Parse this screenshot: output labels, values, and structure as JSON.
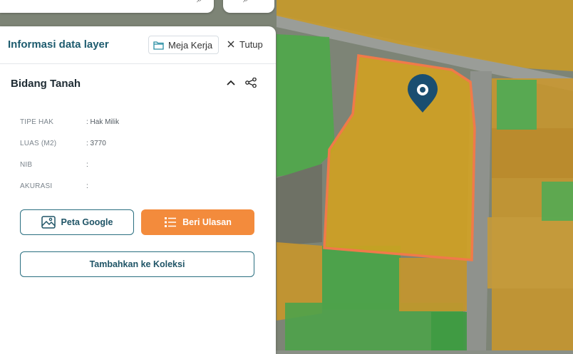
{
  "colors": {
    "accent": "#1d5b6e",
    "primary_button": "#f38b3c",
    "parcel_fill": "#d4a21f",
    "parcel_outline": "#f07a4a",
    "green_parcel": "#4caf50",
    "marker": "#1a4e70"
  },
  "panel": {
    "title": "Informasi data layer",
    "workspace_button": "Meja Kerja",
    "close_button": "Tutup",
    "section_title": "Bidang Tanah",
    "attributes": [
      {
        "label": "TIPE HAK",
        "value": ": Hak Milik"
      },
      {
        "label": "LUAS (M2)",
        "value": ": 3770"
      },
      {
        "label": "NIB",
        "value": ":"
      },
      {
        "label": "AKURASI",
        "value": ":"
      }
    ],
    "buttons": {
      "google_map": "Peta Google",
      "review": "Beri Ulasan",
      "add_collection": "Tambahkan ke Koleksi"
    }
  },
  "icons": {
    "search": "search-icon",
    "folder": "folder-icon",
    "close": "close-icon",
    "collapse": "chevron-up-icon",
    "share": "share-icon",
    "image": "image-icon",
    "list": "list-icon",
    "marker": "location-pin-icon"
  }
}
